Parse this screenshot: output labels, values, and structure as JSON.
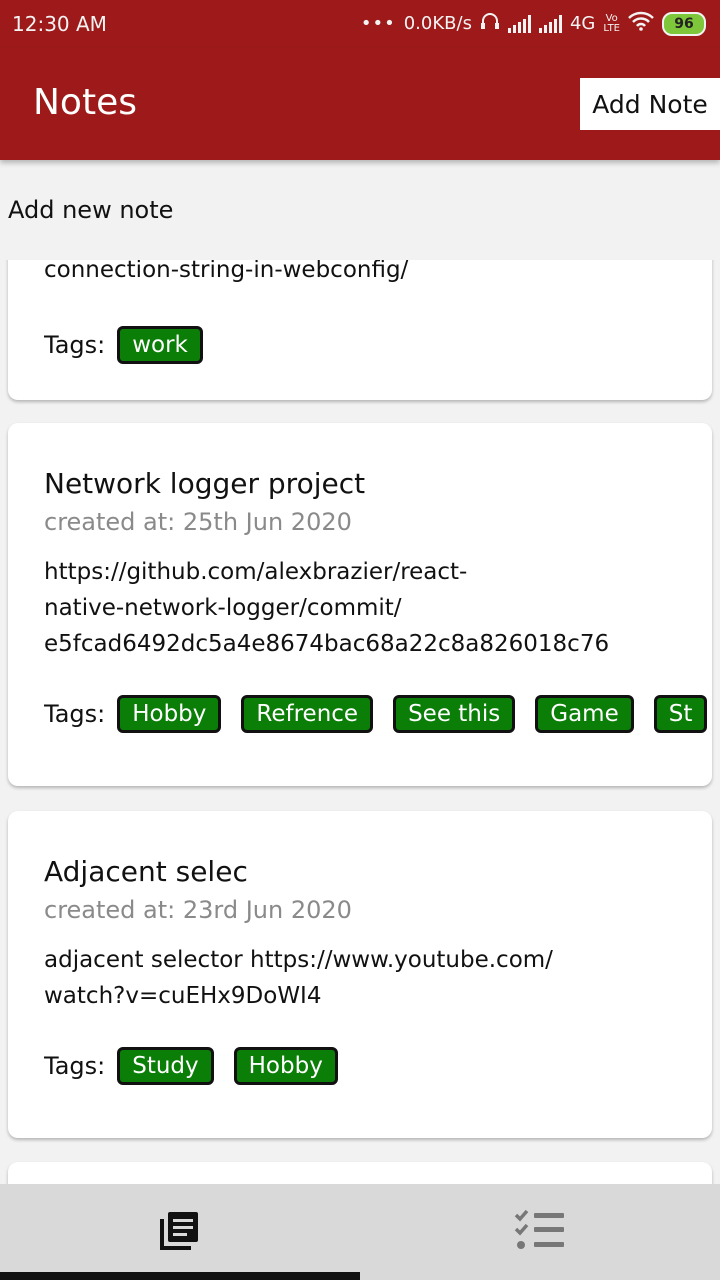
{
  "status_bar": {
    "time": "12:30 AM",
    "dots": "•••",
    "speed": "0.0KB/s",
    "network": "4G",
    "volte_top": "Vo",
    "volte_bottom": "LTE",
    "battery": "96",
    "battery_color": "#7ec63a"
  },
  "header": {
    "title": "Notes",
    "add_button_label": "Add Note",
    "color": "#9e1a1a"
  },
  "add_new_label": "Add new note",
  "tag_color": "#0a7e07",
  "notes": [
    {
      "body_fragment": "connection-string-in-webconfig/",
      "tags_label": "Tags:",
      "tags": [
        "work"
      ]
    },
    {
      "title": "Network logger project",
      "created": "created at: 25th Jun 2020",
      "body_lines": [
        "https://github.com/alexbrazier/react-",
        "native-network-logger/commit/",
        "e5fcad6492dc5a4e8674bac68a22c8a826018c76"
      ],
      "tags_label": "Tags:",
      "tags": [
        "Hobby",
        "Refrence",
        "See this",
        "Game",
        "St"
      ]
    },
    {
      "title": "Adjacent selec",
      "created": "created at: 23rd Jun 2020",
      "body_lines": [
        "adjacent selector https://www.youtube.com/",
        "watch?v=cuEHx9DoWI4"
      ],
      "tags_label": "Tags:",
      "tags": [
        "Study",
        "Hobby"
      ]
    }
  ],
  "tabs": [
    {
      "icon": "notes-list-icon",
      "active": true
    },
    {
      "icon": "checklist-icon",
      "active": false
    }
  ]
}
